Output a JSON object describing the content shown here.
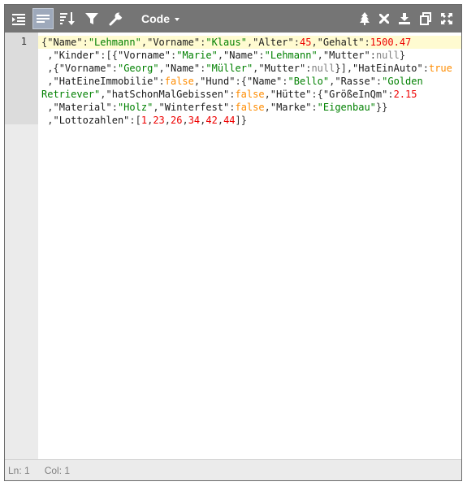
{
  "toolbar": {
    "mode_label": "Code"
  },
  "editor": {
    "line_number": "1",
    "json_text": "{\"Name\":\"Lehmann\",\"Vorname\":\"Klaus\",\"Alter\":45,\"Gehalt\":1500.47,\"Kinder\":[{\"Vorname\":\"Marie\",\"Name\":\"Lehmann\",\"Mutter\":null},{\"Vorname\":\"Georg\",\"Name\":\"Müller\",\"Mutter\":null}],\"HatEinAuto\":true,\"HatEineImmobilie\":false,\"Hund\":{\"Name\":\"Bello\",\"Rasse\":\"Golden Retriever\",\"hatSchonMalGebissen\":false,\"Hütte\":{\"GrößeInQm\":2.15,\"Material\":\"Holz\",\"Winterfest\":false,\"Marke\":\"Eigenbau\"}},\"Lottozahlen\":[1,23,26,34,42,44]}"
  },
  "status": {
    "line": "Ln: 1",
    "column": "Col: 1"
  },
  "colors": {
    "toolbar_bg": "#757575",
    "active_button_bg": "#9ea9bb",
    "gutter_bg": "#ebebeb",
    "active_line_bg": "#fffbd1",
    "key_color": "#1a1a1a",
    "string_color": "#008000",
    "number_color": "#ee0000",
    "boolean_color": "#ff8c00",
    "null_color": "#808080"
  },
  "icons": {
    "toolbar_left": [
      "format-icon",
      "compact-icon",
      "sort-icon",
      "filter-icon",
      "repair-icon"
    ],
    "toolbar_right": [
      "tree-icon",
      "close-icon",
      "download-icon",
      "copy-icon",
      "fullscreen-icon"
    ]
  }
}
